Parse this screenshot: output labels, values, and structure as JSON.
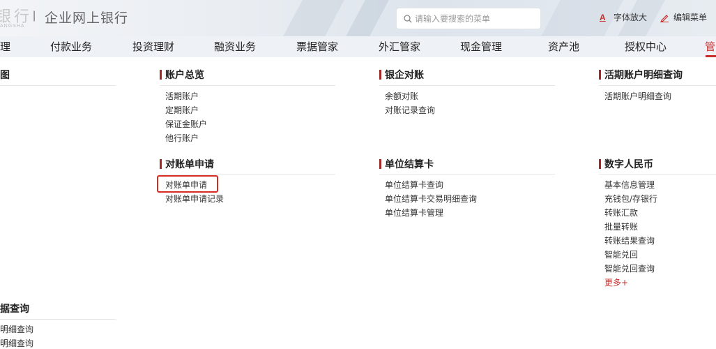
{
  "header": {
    "logo_text": "银行",
    "logo_sub": "ANGSHA",
    "divider": "|",
    "site_title": "企业网上银行",
    "search": {
      "placeholder": "请输入要搜索的菜单"
    },
    "tools": {
      "font_enlarge": "字体放大",
      "edit_menu": "编辑菜单"
    },
    "accent_color": "#c8302d"
  },
  "nav": {
    "items": [
      "理",
      "付款业务",
      "投资理财",
      "融资业务",
      "票据管家",
      "外汇管家",
      "现金管理",
      "资产池",
      "授权中心",
      "管"
    ],
    "active_index": 9
  },
  "sections": {
    "left_top": {
      "title": "图"
    },
    "account_overview": {
      "title": "账户总览",
      "items": [
        "活期账户",
        "定期账户",
        "保证金账户",
        "他行账户"
      ]
    },
    "bank_reconcile": {
      "title": "银企对账",
      "items": [
        "余额对账",
        "对账记录查询"
      ]
    },
    "current_detail": {
      "title": "活期账户明细查询",
      "items": [
        "活期账户明细查询"
      ]
    },
    "statement_apply": {
      "title": "对账单申请",
      "items": [
        "对账单申请",
        "对账单申请记录"
      ],
      "highlighted_index": 0
    },
    "unit_card": {
      "title": "单位结算卡",
      "items": [
        "单位结算卡查询",
        "单位结算卡交易明细查询",
        "单位结算卡管理"
      ]
    },
    "digital_rmb": {
      "title": "数字人民币",
      "items": [
        "基本信息管理",
        "充钱包/存银行",
        "转账汇款",
        "批量转账",
        "转账结果查询",
        "智能兑回",
        "智能兑回查询"
      ],
      "more": "更多+"
    },
    "left_bottom": {
      "title": "据查询",
      "items": [
        "明细查询",
        "明细查询"
      ]
    }
  }
}
